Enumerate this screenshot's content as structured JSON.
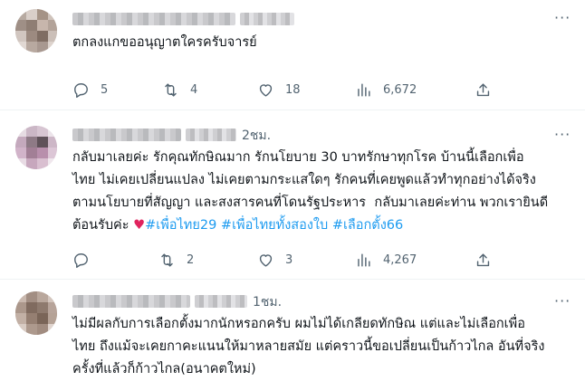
{
  "tweets": [
    {
      "time": "",
      "text": "ตกลงแกขออนุญาตใครครับจารย์",
      "replies": "5",
      "retweets": "4",
      "likes": "18",
      "views": "6,672"
    },
    {
      "time": "2ชม.",
      "text_plain": "กลับมาเลยค่ะ รักคุณทักษิณมาก รักนโยบาย 30 บาทรักษาทุกโรค บ้านนี้เลือกเพื่อ\nไทย ไม่เคยเปลี่ยนแปลง ไม่เคยตามกระแสใดๆ รักคนที่เคยพูดแล้วทำทุกอย่างได้จริง\nตามนโยบายที่สัญญา และสงสารคนที่โดนรัฐประหาร  กลับมาเลยค่ะท่าน พวกเรายินดี\nต้อนรับค่ะ",
      "emoji": "♥",
      "hashtags": [
        "#เพื่อไทย29",
        "#เพื่อไทยทั้งสองใบ",
        "#เลือกตั้ง66"
      ],
      "replies": "",
      "retweets": "2",
      "likes": "3",
      "views": "4,267"
    },
    {
      "time": "1ชม.",
      "text": "ไม่มีผลกับการเลือกตั้งมากนักหรอกครับ ผมไม่ได้เกลียดทักษิณ แต่และไม่เลือกเพื่อ\nไทย ถึงแม้จะเคยกาคะแนนให้มาหลายสมัย แต่คราวนี้ขอเปลี่ยนเป็นก้าวไกล อันที่จริง\nครั้งที่แล้วก็ก้าวไกล(อนาคตใหม่)"
    }
  ],
  "more_label": "···",
  "icons": [
    "reply-icon",
    "retweet-icon",
    "like-icon",
    "views-icon",
    "share-icon"
  ],
  "colors": {
    "text": "#0f1419",
    "muted": "#536471",
    "link": "#1d9bf0",
    "heart": "#e0245e"
  }
}
